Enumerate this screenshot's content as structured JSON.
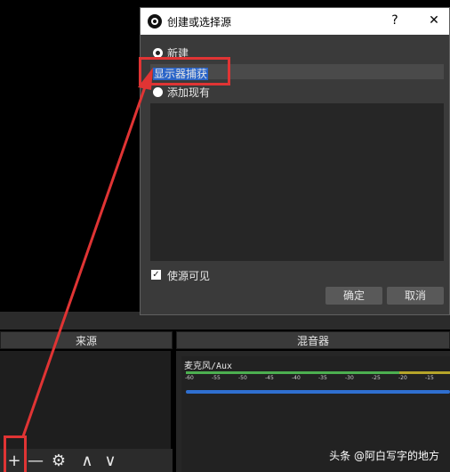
{
  "dialog": {
    "title": "创建或选择源",
    "help_label": "?",
    "close_label": "✕",
    "create_new_label": "新建",
    "name_value": "显示器捕获",
    "add_existing_label": "添加现有",
    "make_visible_label": "使源可见",
    "make_visible_checked": true,
    "ok_label": "确定",
    "cancel_label": "取消"
  },
  "panels": {
    "sources_title": "来源",
    "mixer_title": "混音器"
  },
  "mixer": {
    "track_name": "麦克风/Aux",
    "scale": [
      "-60",
      "-55",
      "-50",
      "-45",
      "-40",
      "-35",
      "-30",
      "-25",
      "-20",
      "-15"
    ]
  },
  "toolbar": {
    "add_label": "+",
    "remove_label": "—",
    "settings_label": "⚙",
    "up_label": "∧",
    "down_label": "∨"
  },
  "colors": {
    "annotation": "#e03434",
    "selection": "#2a64c8",
    "fader": "#2f6fd0"
  },
  "watermark": "头条 @阿白写字的地方"
}
